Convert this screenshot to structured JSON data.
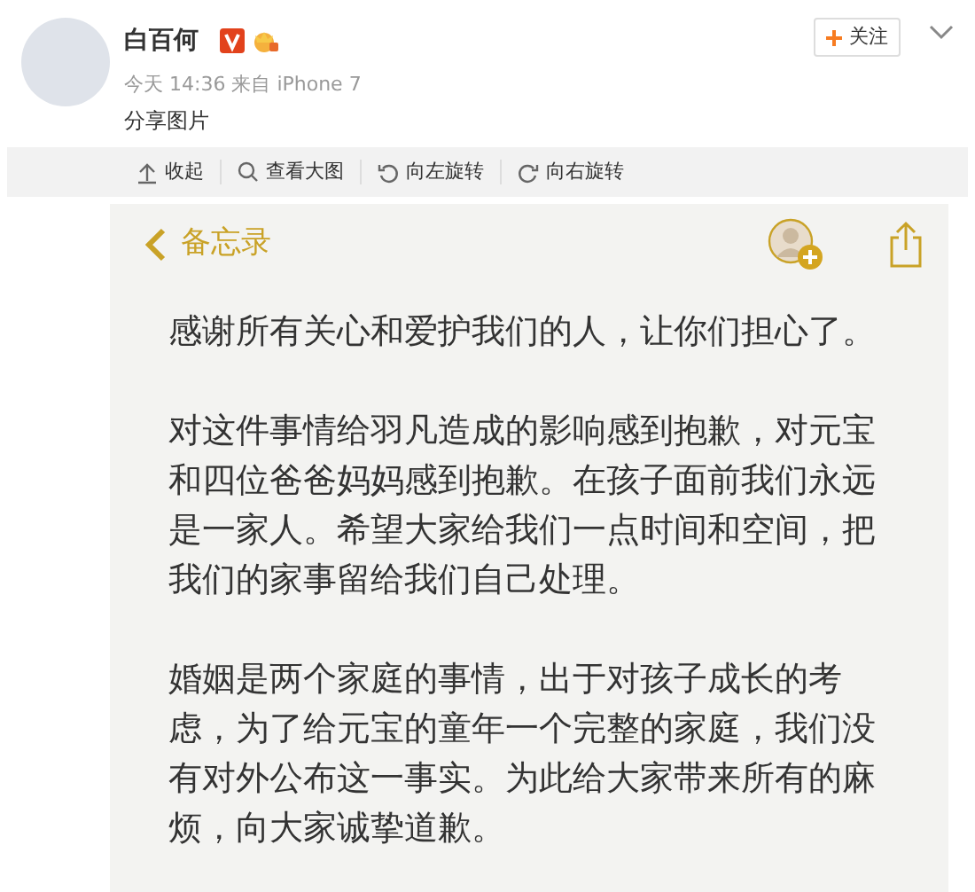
{
  "post": {
    "author": "白百何",
    "meta": "今天 14:36 来自 iPhone 7",
    "text": "分享图片",
    "follow_label": "关注"
  },
  "toolbar": [
    {
      "kind": "collapse",
      "label": "收起"
    },
    {
      "kind": "zoom",
      "label": "查看大图"
    },
    {
      "kind": "rotate-left",
      "label": "向左旋转"
    },
    {
      "kind": "rotate-right",
      "label": "向右旋转"
    }
  ],
  "notes": {
    "back_label": "备忘录",
    "paragraphs": [
      "感谢所有关心和爱护我们的人，让你们担心了。",
      "对这件事情给羽凡造成的影响感到抱歉，对元宝和四位爸爸妈妈感到抱歉。在孩子面前我们永远是一家人。希望大家给我们一点时间和空间，把我们的家事留给我们自己处理。",
      "婚姻是两个家庭的事情，出于对孩子成长的考虑，为了给元宝的童年一个完整的家庭，我们没有对外公布这一事实。为此给大家带来所有的麻烦，向大家诚挚道歉。"
    ]
  }
}
